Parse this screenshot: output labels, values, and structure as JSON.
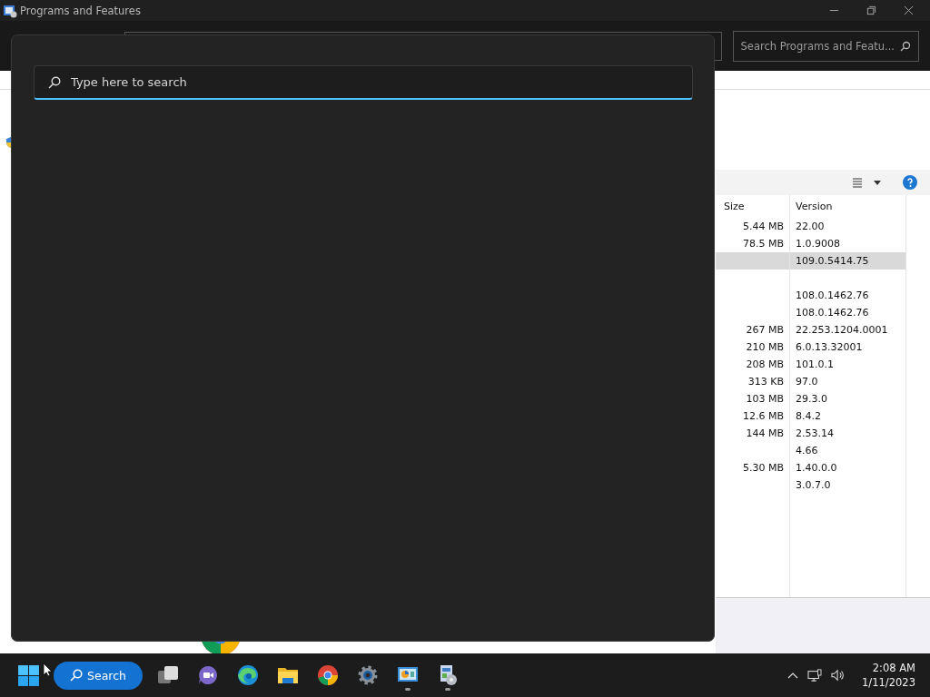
{
  "window": {
    "title": "Programs and Features",
    "search_placeholder": "Search Programs and Featu..."
  },
  "programs_list": {
    "columns": [
      "Size",
      "Version"
    ],
    "rows": [
      {
        "size": "5.44 MB",
        "version": "22.00",
        "selected": false
      },
      {
        "size": "78.5 MB",
        "version": "1.0.9008",
        "selected": false
      },
      {
        "version": "109.0.5414.75",
        "selected": true
      },
      {
        "selected": false
      },
      {
        "version": "108.0.1462.76",
        "selected": false
      },
      {
        "version": "108.0.1462.76",
        "selected": false
      },
      {
        "size": "267 MB",
        "version": "22.253.1204.0001",
        "selected": false
      },
      {
        "size": "210 MB",
        "version": "6.0.13.32001",
        "selected": false
      },
      {
        "size": "208 MB",
        "version": "101.0.1",
        "selected": false
      },
      {
        "size": "313 KB",
        "version": "97.0",
        "selected": false
      },
      {
        "size": "103 MB",
        "version": "29.3.0",
        "selected": false
      },
      {
        "size": "12.6 MB",
        "version": "8.4.2",
        "selected": false
      },
      {
        "size": "144 MB",
        "version": "2.53.14",
        "selected": false
      },
      {
        "version": "4.66",
        "selected": false
      },
      {
        "size": "5.30 MB",
        "version": "1.40.0.0",
        "selected": false
      },
      {
        "version": "3.0.7.0",
        "selected": false
      }
    ]
  },
  "start_search": {
    "placeholder": "Type here to search"
  },
  "taskbar": {
    "search_label": "Search",
    "apps": [
      {
        "kind": "task-view",
        "running": false
      },
      {
        "kind": "meet",
        "running": false
      },
      {
        "kind": "edge",
        "running": false
      },
      {
        "kind": "folder",
        "running": false
      },
      {
        "kind": "chrome",
        "running": false
      },
      {
        "kind": "settings",
        "running": false
      },
      {
        "kind": "control-panel",
        "running": true
      },
      {
        "kind": "programs",
        "running": true
      }
    ],
    "time": "2:08 AM",
    "date": "1/11/2023"
  }
}
